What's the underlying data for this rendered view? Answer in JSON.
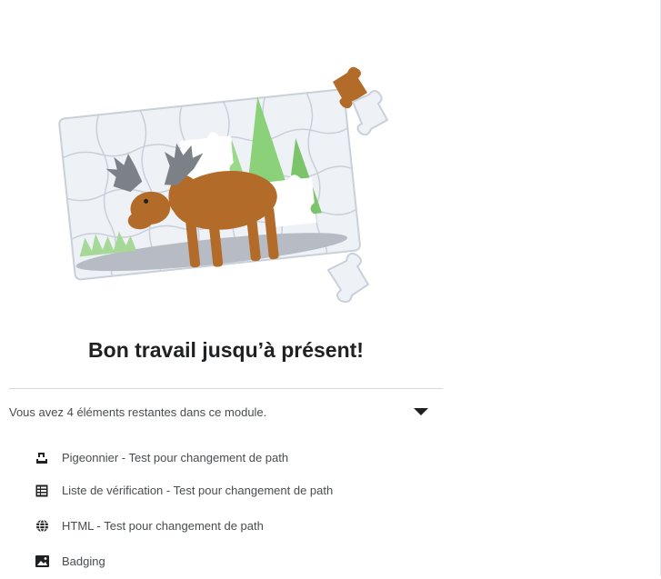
{
  "heading": "Bon travail jusqu’à présent!",
  "remaining": {
    "text": "Vous avez 4 éléments restantes dans ce module.",
    "expanded": true
  },
  "items": [
    {
      "label": "Pigeonnier - Test pour changement de path",
      "icon": "assignment-dropbox-icon"
    },
    {
      "label": "Liste de vérification - Test pour changement de path",
      "icon": "checklist-icon"
    },
    {
      "label": "HTML - Test pour changement de path",
      "icon": "globe-icon"
    },
    {
      "label": "Badging",
      "icon": "image-icon"
    }
  ],
  "colors": {
    "moose_body": "#b36b2a",
    "antlers": "#7c8188",
    "puzzle_bg": "#eef1f6",
    "tree_green": "#8bd17a",
    "divider": "#d3d9e3"
  }
}
